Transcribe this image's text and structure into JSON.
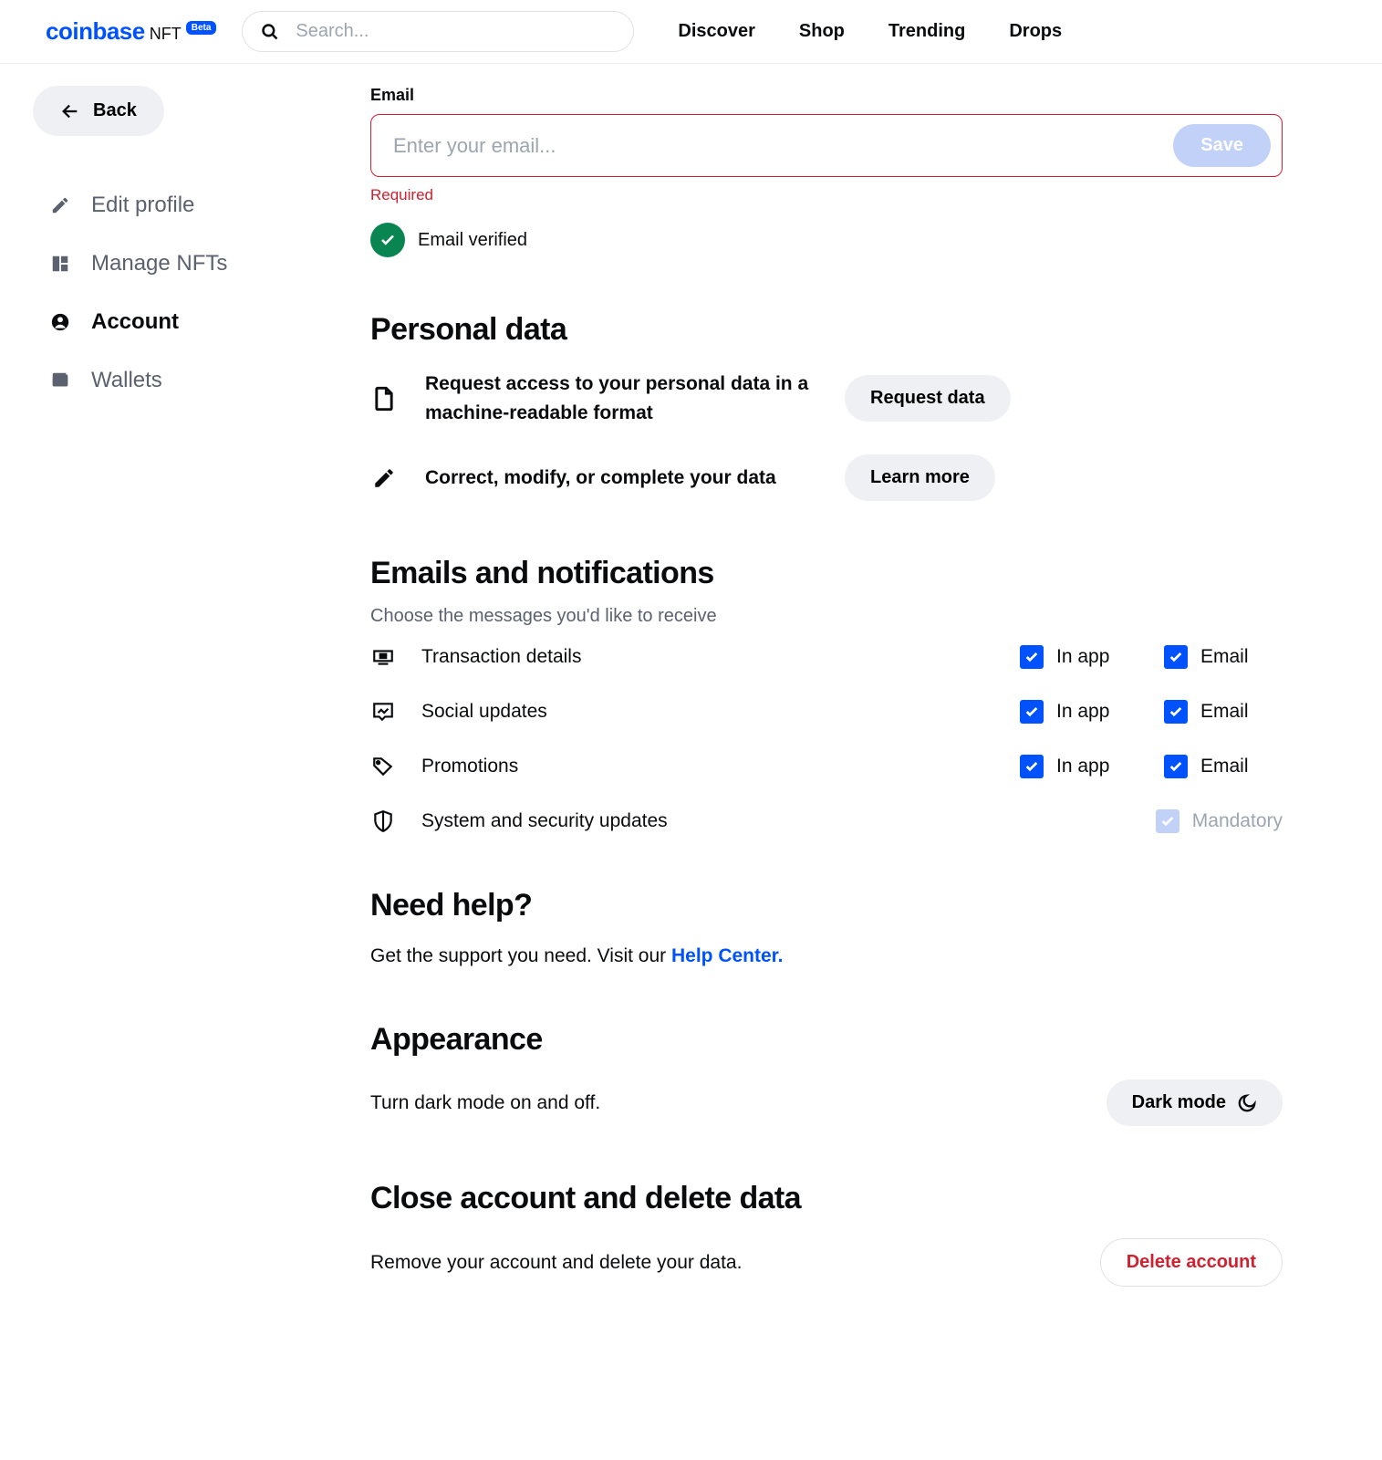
{
  "header": {
    "logo_main": "coinbase",
    "logo_nft": "NFT",
    "beta": "Beta",
    "search_placeholder": "Search...",
    "nav": [
      "Discover",
      "Shop",
      "Trending",
      "Drops"
    ]
  },
  "sidebar": {
    "back": "Back",
    "items": [
      {
        "label": "Edit profile",
        "active": false
      },
      {
        "label": "Manage NFTs",
        "active": false
      },
      {
        "label": "Account",
        "active": true
      },
      {
        "label": "Wallets",
        "active": false
      }
    ]
  },
  "email": {
    "label": "Email",
    "placeholder": "Enter your email...",
    "save": "Save",
    "error": "Required",
    "verified": "Email verified"
  },
  "personal": {
    "heading": "Personal data",
    "row1": "Request access to your personal data in a machine-readable format",
    "row1_btn": "Request data",
    "row2": "Correct, modify, or complete your data",
    "row2_btn": "Learn more"
  },
  "notif": {
    "heading": "Emails and notifications",
    "sub": "Choose the messages you'd like to receive",
    "col_inapp": "In app",
    "col_email": "Email",
    "col_mandatory": "Mandatory",
    "rows": [
      {
        "label": "Transaction details"
      },
      {
        "label": "Social updates"
      },
      {
        "label": "Promotions"
      },
      {
        "label": "System and security updates"
      }
    ]
  },
  "help": {
    "heading": "Need help?",
    "text": "Get the support you need. Visit our ",
    "link": "Help Center."
  },
  "appearance": {
    "heading": "Appearance",
    "text": "Turn dark mode on and off.",
    "btn": "Dark mode"
  },
  "close": {
    "heading": "Close account and delete data",
    "text": "Remove your account and delete your data.",
    "btn": "Delete account"
  }
}
